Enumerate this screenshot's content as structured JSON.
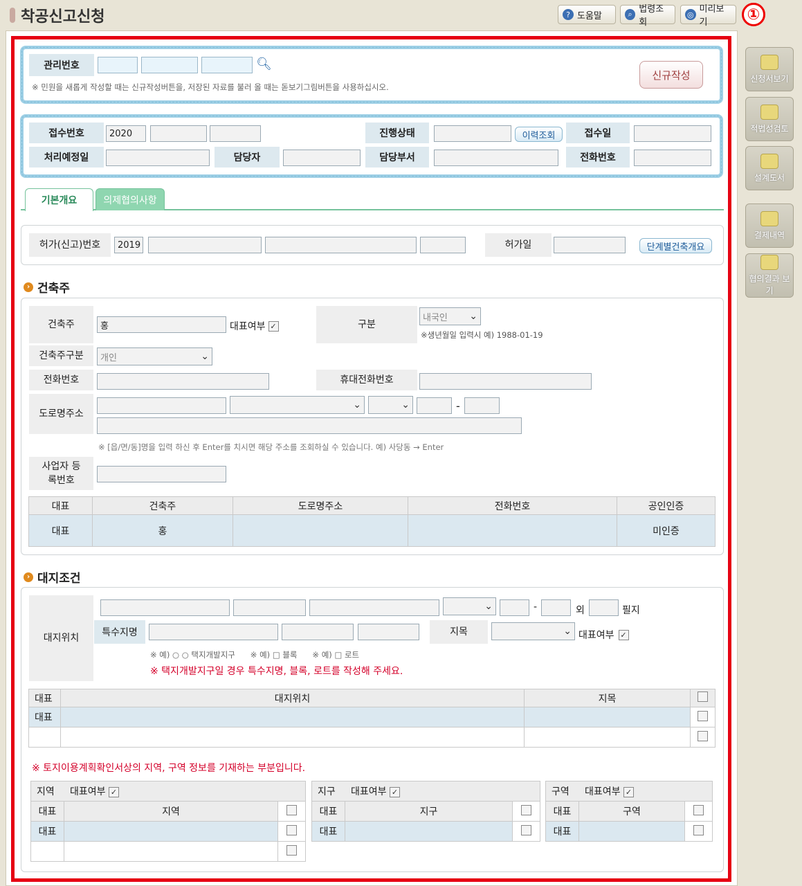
{
  "header": {
    "title": "착공신고신청",
    "help": "도움말",
    "law": "법령조회",
    "preview": "미리보기",
    "marker": "①"
  },
  "side": [
    "신청서보기",
    "적법성검토",
    "설계도서",
    "결제내역",
    "협의결과 보기"
  ],
  "mgmt": {
    "label": "관리번호",
    "new_button": "신규작성",
    "note": "※ 민원을 새롭게 작성할 때는 신규작성버튼을, 저장된 자료를 불러 올 때는 돋보기그림버튼을 사용하십시오."
  },
  "receipt": {
    "no_label": "접수번호",
    "no_year": "2020",
    "status_label": "진행상태",
    "history_button": "이력조회",
    "date_label": "접수일",
    "plan_label": "처리예정일",
    "manager_label": "담당자",
    "dept_label": "담당부서",
    "phone_label": "전화번호"
  },
  "tabs": [
    "기본개요",
    "의제협의사항"
  ],
  "permit": {
    "label": "허가(신고)번호",
    "year": "2019",
    "date_label": "허가일",
    "stage_button": "단계별건축개요"
  },
  "owner": {
    "section": "건축주",
    "name_label": "건축주",
    "name_value": "홍",
    "rep_label": "대표여부",
    "type_label": "구분",
    "type_value": "내국인",
    "birth_note": "※생년월일 입력시 예) 1988-01-19",
    "kind_label": "건축주구분",
    "kind_value": "개인",
    "phone_label": "전화번호",
    "mobile_label": "휴대전화번호",
    "addr_label": "도로명주소",
    "addr_dash": "-",
    "addr_note": "※ [읍/면/동]명을 입력 하신 후 Enter를 치시면 해당 주소를 조회하실 수 있습니다. 예) 사당동 → Enter",
    "biz_label": "사업자 등록번호",
    "table": {
      "headers": [
        "대표",
        "건축주",
        "도로명주소",
        "전화번호",
        "공인인증"
      ],
      "row": [
        "대표",
        "홍",
        "",
        "",
        "미인증"
      ]
    }
  },
  "site": {
    "section": "대지조건",
    "loc_label": "대지위치",
    "dash": "-",
    "extra": "외",
    "lots": "필지",
    "special_label": "특수지명",
    "jimok_label": "지목",
    "rep_label": "대표여부",
    "ex_note": "※ 예) ○ ○ 택지개발지구      ※ 예) □ 블록      ※ 예) □ 로트",
    "warn": "※ 택지개발지구일 경우 특수지명, 블록, 로트를 작성해 주세요.",
    "table": {
      "headers": [
        "대표",
        "대지위치",
        "지목"
      ],
      "row1": "대표"
    },
    "land_note": "※ 토지이용계획확인서상의 지역, 구역 정보를 기재하는 부분입니다.",
    "zones": [
      {
        "title": "지역",
        "rep": "대표여부",
        "h1": "대표",
        "h2": "지역",
        "r1": "대표"
      },
      {
        "title": "지구",
        "rep": "대표여부",
        "h1": "대표",
        "h2": "지구",
        "r1": "대표"
      },
      {
        "title": "구역",
        "rep": "대표여부",
        "h1": "대표",
        "h2": "구역",
        "r1": "대표"
      }
    ]
  }
}
